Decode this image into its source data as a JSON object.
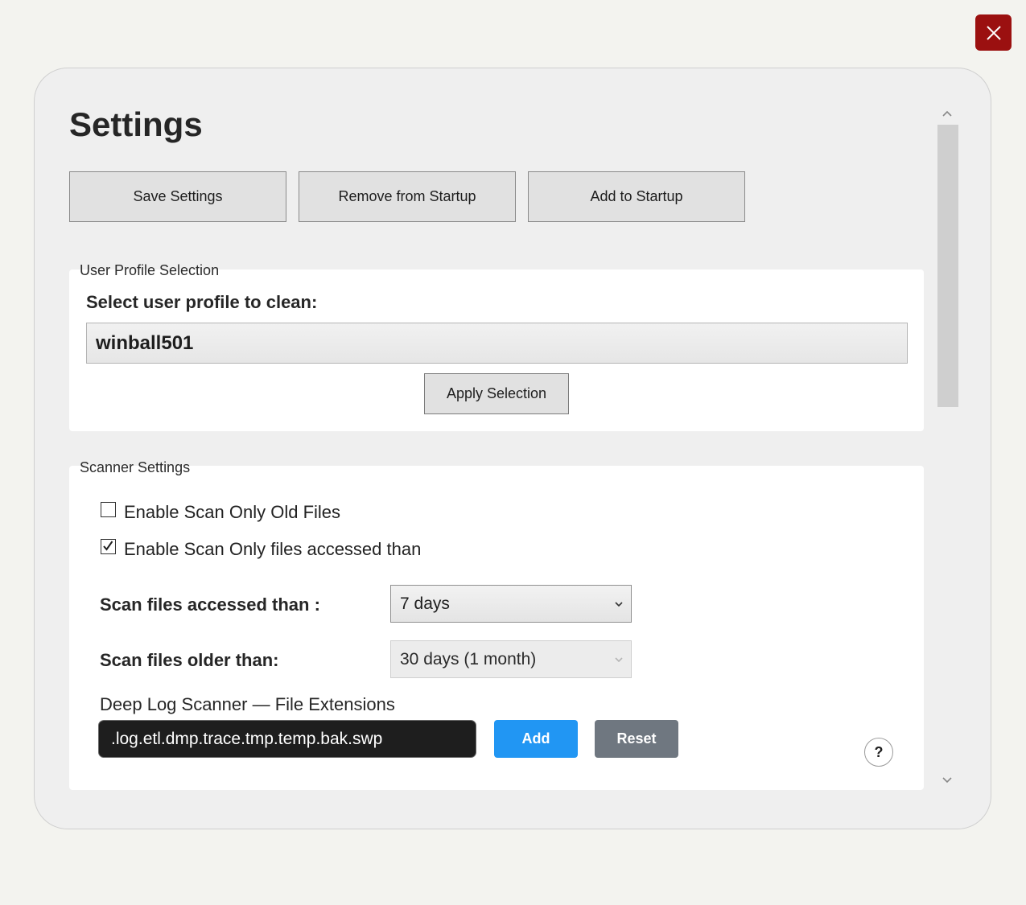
{
  "window": {
    "close_icon": "close-icon",
    "close_color": "#9b1010"
  },
  "settings": {
    "title": "Settings",
    "toolbar": {
      "save_label": "Save Settings",
      "remove_startup_label": "Remove from Startup",
      "add_startup_label": "Add to Startup"
    },
    "user_profile": {
      "legend": "User Profile Selection",
      "prompt": "Select user profile to clean:",
      "selected_profile": "winball501",
      "apply_label": "Apply Selection"
    },
    "scanner": {
      "legend": "Scanner Settings",
      "options": [
        {
          "label": "Enable Scan Only Old Files",
          "checked": false
        },
        {
          "label": "Enable Scan Only files accessed than",
          "checked": true
        }
      ],
      "accessed_label": "Scan files accessed than :",
      "accessed_value": "7 days",
      "older_label": "Scan files older than:",
      "older_value": "30 days (1 month)",
      "deep_log_title": "Deep Log Scanner — File Extensions",
      "extensions_value": ".log.etl.dmp.trace.tmp.temp.bak.swp",
      "add_label": "Add",
      "reset_label": "Reset",
      "help_label": "?",
      "add_color": "#2196f3",
      "reset_color": "#6f7780"
    }
  }
}
